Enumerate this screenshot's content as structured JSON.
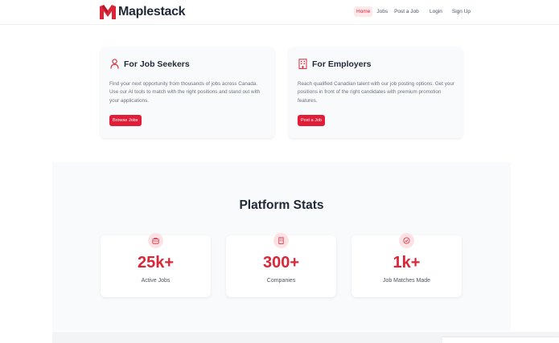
{
  "brand": {
    "name": "Maplestack",
    "accent": "#dc2638"
  },
  "nav": {
    "main": [
      {
        "label": "Home",
        "active": true
      },
      {
        "label": "Jobs",
        "active": false
      },
      {
        "label": "Post a Job",
        "active": false
      }
    ],
    "auth": [
      {
        "label": "Login"
      },
      {
        "label": "Sign Up"
      }
    ]
  },
  "seekers": {
    "icon": "user-icon",
    "title": "For Job Seekers",
    "description": "Find your next opportunity from thousands of jobs across Canada. Use our AI tools to match with the right positions and stand out with your applications.",
    "button": "Browse Jobs"
  },
  "employers": {
    "icon": "building-icon",
    "title": "For Employers",
    "description": "Reach qualified Canadian talent with our job posting options. Get your positions in front of the right candidates with premium promotion features.",
    "button": "Post a Job"
  },
  "stats": {
    "title": "Platform Stats",
    "items": [
      {
        "icon": "briefcase-icon",
        "value": "25k+",
        "label": "Active Jobs"
      },
      {
        "icon": "building-icon",
        "value": "300+",
        "label": "Companies"
      },
      {
        "icon": "check-circle-icon",
        "value": "1k+",
        "label": "Job Matches Made"
      }
    ]
  }
}
